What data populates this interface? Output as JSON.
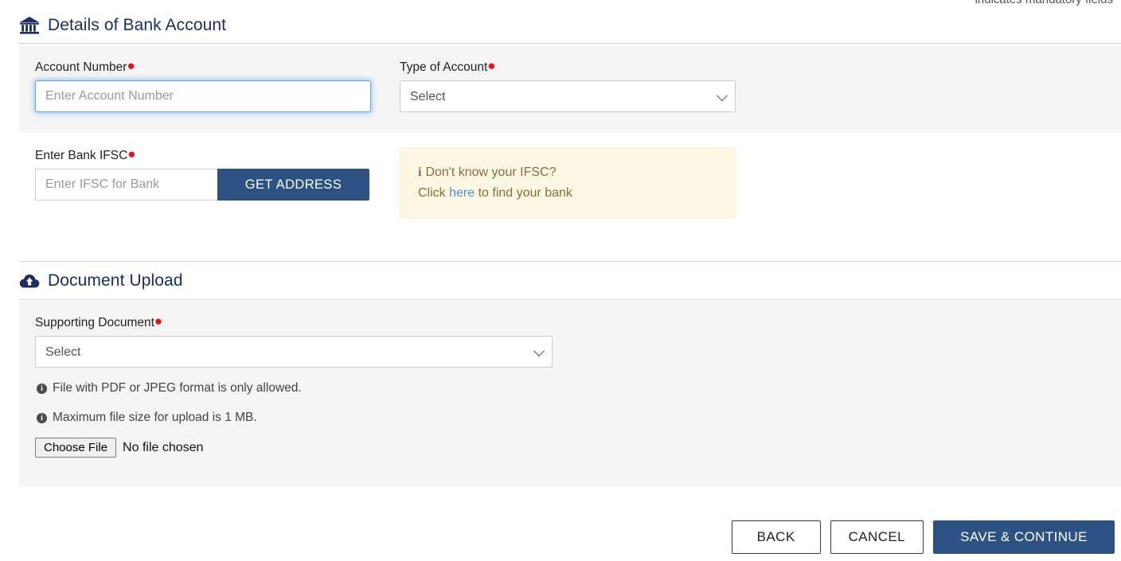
{
  "mandatory_note": "indicates mandatory fields",
  "bank_section": {
    "icon": "bank-building-icon",
    "title": "Details of Bank Account",
    "account_number": {
      "label": "Account Number",
      "required_marker": "●",
      "placeholder": "Enter Account Number",
      "value": ""
    },
    "type_of_account": {
      "label": "Type of Account",
      "required_marker": "●",
      "selected": "Select",
      "options": [
        "Select"
      ]
    },
    "ifsc": {
      "label": "Enter Bank IFSC",
      "required_marker": "●",
      "placeholder": "Enter IFSC for Bank",
      "value": "",
      "button_label": "GET ADDRESS"
    },
    "ifsc_info": {
      "icon": "info-italic-icon",
      "line1": "Don't know your IFSC?",
      "line2_prefix": "Click ",
      "link_text": "here",
      "line2_suffix": " to find your bank"
    }
  },
  "upload_section": {
    "icon": "cloud-upload-icon",
    "title": "Document Upload",
    "supporting_document": {
      "label": "Supporting Document",
      "required_marker": "●",
      "selected": "Select",
      "options": [
        "Select"
      ]
    },
    "hints": [
      {
        "icon": "info-circle-icon",
        "text": "File with PDF or JPEG format is only allowed."
      },
      {
        "icon": "info-circle-icon",
        "text": "Maximum file size for upload is 1 MB."
      }
    ],
    "file_picker": {
      "button_label": "Choose File",
      "status": "No file chosen"
    }
  },
  "footer": {
    "back_label": "BACK",
    "cancel_label": "CANCEL",
    "save_label": "SAVE & CONTINUE"
  },
  "colors": {
    "heading": "#1c2e63",
    "primary": "#2c5183",
    "panel": "#f5f5f5",
    "required": "#e8111c",
    "info_bg": "#fcf8e3",
    "info_text": "#8a6d3b",
    "link": "#4a90d9"
  }
}
